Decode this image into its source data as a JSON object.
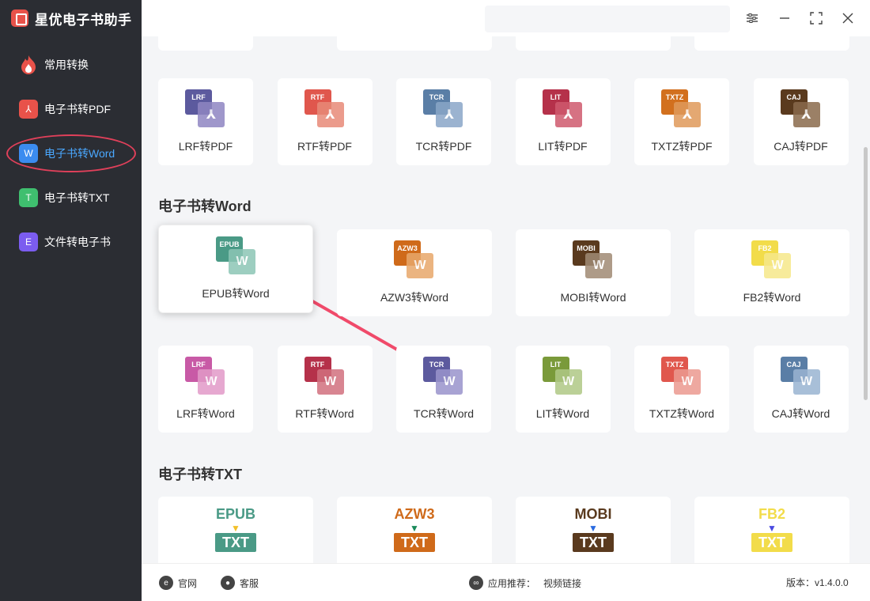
{
  "app": {
    "title": "星优电子书助手"
  },
  "sidebar": {
    "items": [
      {
        "label": "常用转换",
        "icon": "fire-icon",
        "color": "#e8524a",
        "glyph": ""
      },
      {
        "label": "电子书转PDF",
        "icon": "pdf-icon",
        "color": "#e8524a",
        "glyph": "⅄"
      },
      {
        "label": "电子书转Word",
        "icon": "word-icon",
        "color": "#3b8cf0",
        "glyph": "W"
      },
      {
        "label": "电子书转TXT",
        "icon": "txt-icon",
        "color": "#3fbf6f",
        "glyph": "T"
      },
      {
        "label": "文件转电子书",
        "icon": "ebook-icon",
        "color": "#7b5cf0",
        "glyph": "E"
      }
    ]
  },
  "sections": {
    "word_title": "电子书转Word",
    "txt_title": "电子书转TXT"
  },
  "pdf_cards": [
    {
      "label": "LRF转PDF",
      "tag": "LRF",
      "color": "#5c5a9e",
      "color2": "#8f86c2"
    },
    {
      "label": "RTF转PDF",
      "tag": "RTF",
      "color": "#e0574d",
      "color2": "#e88a78"
    },
    {
      "label": "TCR转PDF",
      "tag": "TCR",
      "color": "#5a7ea6",
      "color2": "#8aa6c8"
    },
    {
      "label": "LIT转PDF",
      "tag": "LIT",
      "color": "#b5314a",
      "color2": "#cf5a6e"
    },
    {
      "label": "TXTZ转PDF",
      "tag": "TXTZ",
      "color": "#d2701e",
      "color2": "#e09a5a"
    },
    {
      "label": "CAJ转PDF",
      "tag": "CAJ",
      "color": "#5a3a1e",
      "color2": "#8a6a4c"
    }
  ],
  "word_cards_row1": [
    {
      "label": "EPUB转Word",
      "tag": "EPUB",
      "color": "#4a9a86",
      "color2": "#8cc6b6"
    },
    {
      "label": "AZW3转Word",
      "tag": "AZW3",
      "color": "#cf6a1a",
      "color2": "#e8a86a"
    },
    {
      "label": "MOBI转Word",
      "tag": "MOBI",
      "color": "#5a3a1e",
      "color2": "#a08a74"
    },
    {
      "label": "FB2转Word",
      "tag": "FB2",
      "color": "#f2dc4a",
      "color2": "#f6e88a"
    }
  ],
  "word_cards_row2": [
    {
      "label": "LRF转Word",
      "tag": "LRF",
      "color": "#c85aa6",
      "color2": "#e29ac8"
    },
    {
      "label": "RTF转Word",
      "tag": "RTF",
      "color": "#b5314a",
      "color2": "#d2707e"
    },
    {
      "label": "TCR转Word",
      "tag": "TCR",
      "color": "#5c5a9e",
      "color2": "#9a94cc"
    },
    {
      "label": "LIT转Word",
      "tag": "LIT",
      "color": "#7a9a3a",
      "color2": "#b0c886"
    },
    {
      "label": "TXTZ转Word",
      "tag": "TXTZ",
      "color": "#e0574d",
      "color2": "#ec9a90"
    },
    {
      "label": "CAJ转Word",
      "tag": "CAJ",
      "color": "#5a7ea6",
      "color2": "#9ab4d2"
    }
  ],
  "txt_cards": [
    {
      "tag": "EPUB",
      "color": "#4a9a86",
      "arrow": "#f2c02a"
    },
    {
      "tag": "AZW3",
      "color": "#cf6a1a",
      "arrow": "#1a8a5a"
    },
    {
      "tag": "MOBI",
      "color": "#5a3a1e",
      "arrow": "#2a6ae0"
    },
    {
      "tag": "FB2",
      "color": "#f2dc4a",
      "arrow": "#4a4ae0"
    }
  ],
  "txt_label": "TXT",
  "footer": {
    "website": "官网",
    "service": "客服",
    "recommend": "应用推荐：",
    "video": "视频链接",
    "version": "版本：v1.4.0.0"
  }
}
